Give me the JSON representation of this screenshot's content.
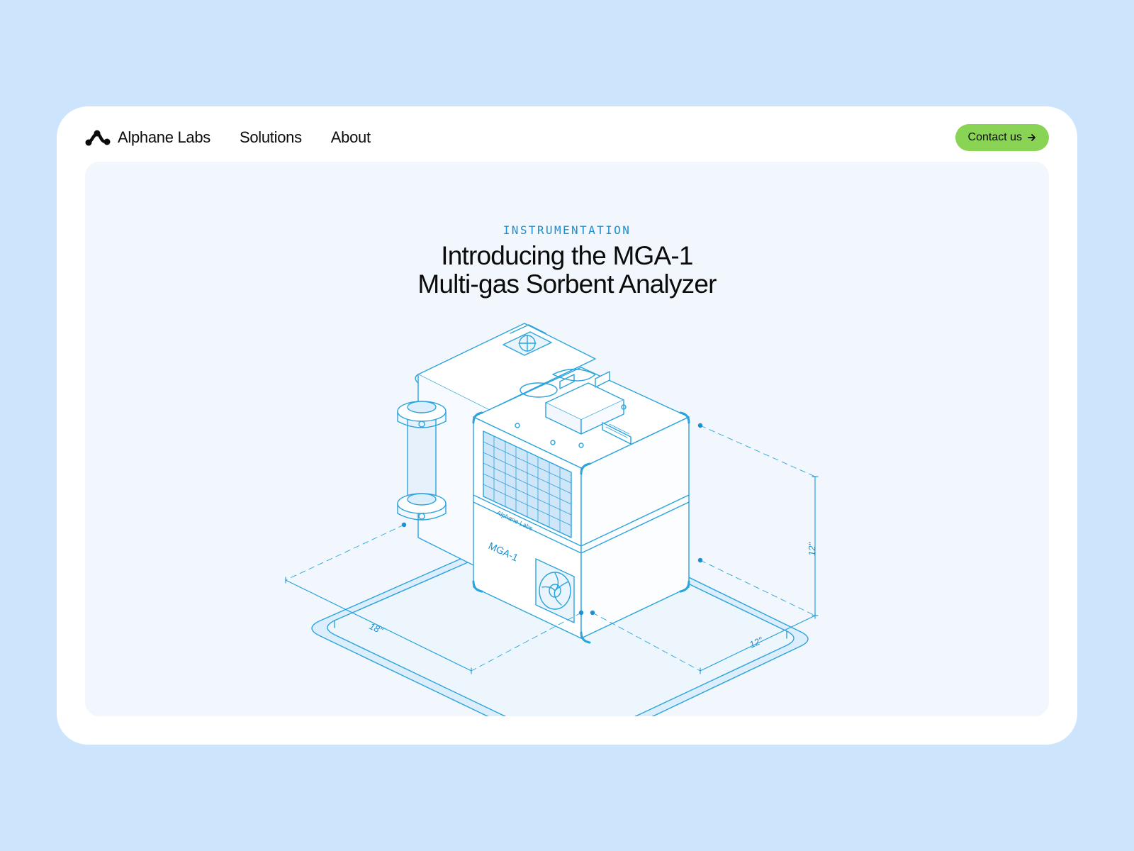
{
  "nav": {
    "brand": "Alphane Labs",
    "links": [
      "Solutions",
      "About"
    ],
    "cta_label": "Contact us"
  },
  "hero": {
    "eyebrow": "INSTRUMENTATION",
    "title_line1": "Introducing the MGA-1",
    "title_line2": "Multi-gas Sorbent Analyzer"
  },
  "illustration": {
    "device_brand": "Alphane Labs",
    "device_model": "MGA-1",
    "dimension_length": "18\"",
    "dimension_width": "12\"",
    "dimension_height": "12\""
  },
  "colors": {
    "background": "#cce5fc",
    "card": "#ffffff",
    "hero_panel": "#f1f7fd",
    "accent_blue": "#1a8fd2",
    "cta_green": "#8ad455"
  },
  "icons": {
    "brand_logo": "alphane-logo-icon",
    "cta_arrow": "arrow-right-icon"
  }
}
